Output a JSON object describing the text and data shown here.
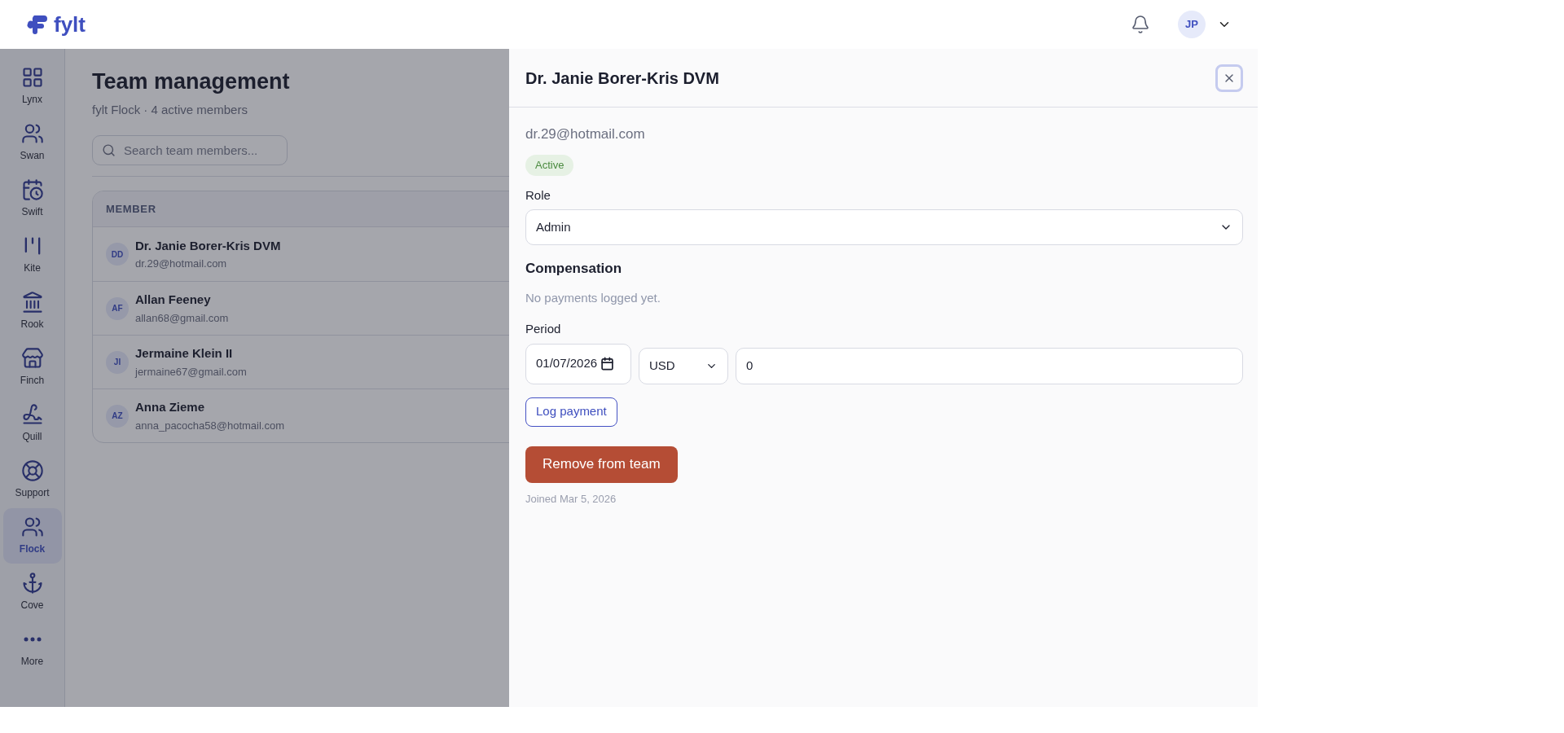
{
  "header": {
    "logo": "fylt",
    "avatar": "JP"
  },
  "sidebar": {
    "items": [
      {
        "label": "Lynx",
        "selected": false
      },
      {
        "label": "Swan",
        "selected": false
      },
      {
        "label": "Swift",
        "selected": false
      },
      {
        "label": "Kite",
        "selected": false
      },
      {
        "label": "Rook",
        "selected": false
      },
      {
        "label": "Finch",
        "selected": false
      },
      {
        "label": "Quill",
        "selected": false
      },
      {
        "label": "Support",
        "selected": false
      },
      {
        "label": "Flock",
        "selected": true
      },
      {
        "label": "Cove",
        "selected": false
      },
      {
        "label": "More",
        "selected": false
      }
    ]
  },
  "page": {
    "title": "Team management",
    "subtitle": "fylt Flock · 4 active members",
    "search": {
      "placeholder": "Search team members..."
    }
  },
  "table": {
    "columns": [
      "MEMBER"
    ],
    "rows": [
      {
        "initials": "DD",
        "name": "Dr. Janie Borer-Kris DVM",
        "email": "dr.29@hotmail.com"
      },
      {
        "initials": "AF",
        "name": "Allan Feeney",
        "email": "allan68@gmail.com"
      },
      {
        "initials": "JI",
        "name": "Jermaine Klein II",
        "email": "jermaine67@gmail.com"
      },
      {
        "initials": "AZ",
        "name": "Anna Zieme",
        "email": "anna_pacocha58@hotmail.com"
      }
    ]
  },
  "panel": {
    "title": "Dr. Janie Borer-Kris DVM",
    "email": "dr.29@hotmail.com",
    "status": "Active",
    "role_label": "Role",
    "role_value": "Admin",
    "compensation_title": "Compensation",
    "compensation_empty": "No payments logged yet.",
    "period_label": "Period",
    "date_value": "01/07/2026",
    "currency": "USD",
    "amount": "0",
    "log_button": "Log payment",
    "remove_button": "Remove from team",
    "joined": "Joined Mar 5, 2026"
  }
}
